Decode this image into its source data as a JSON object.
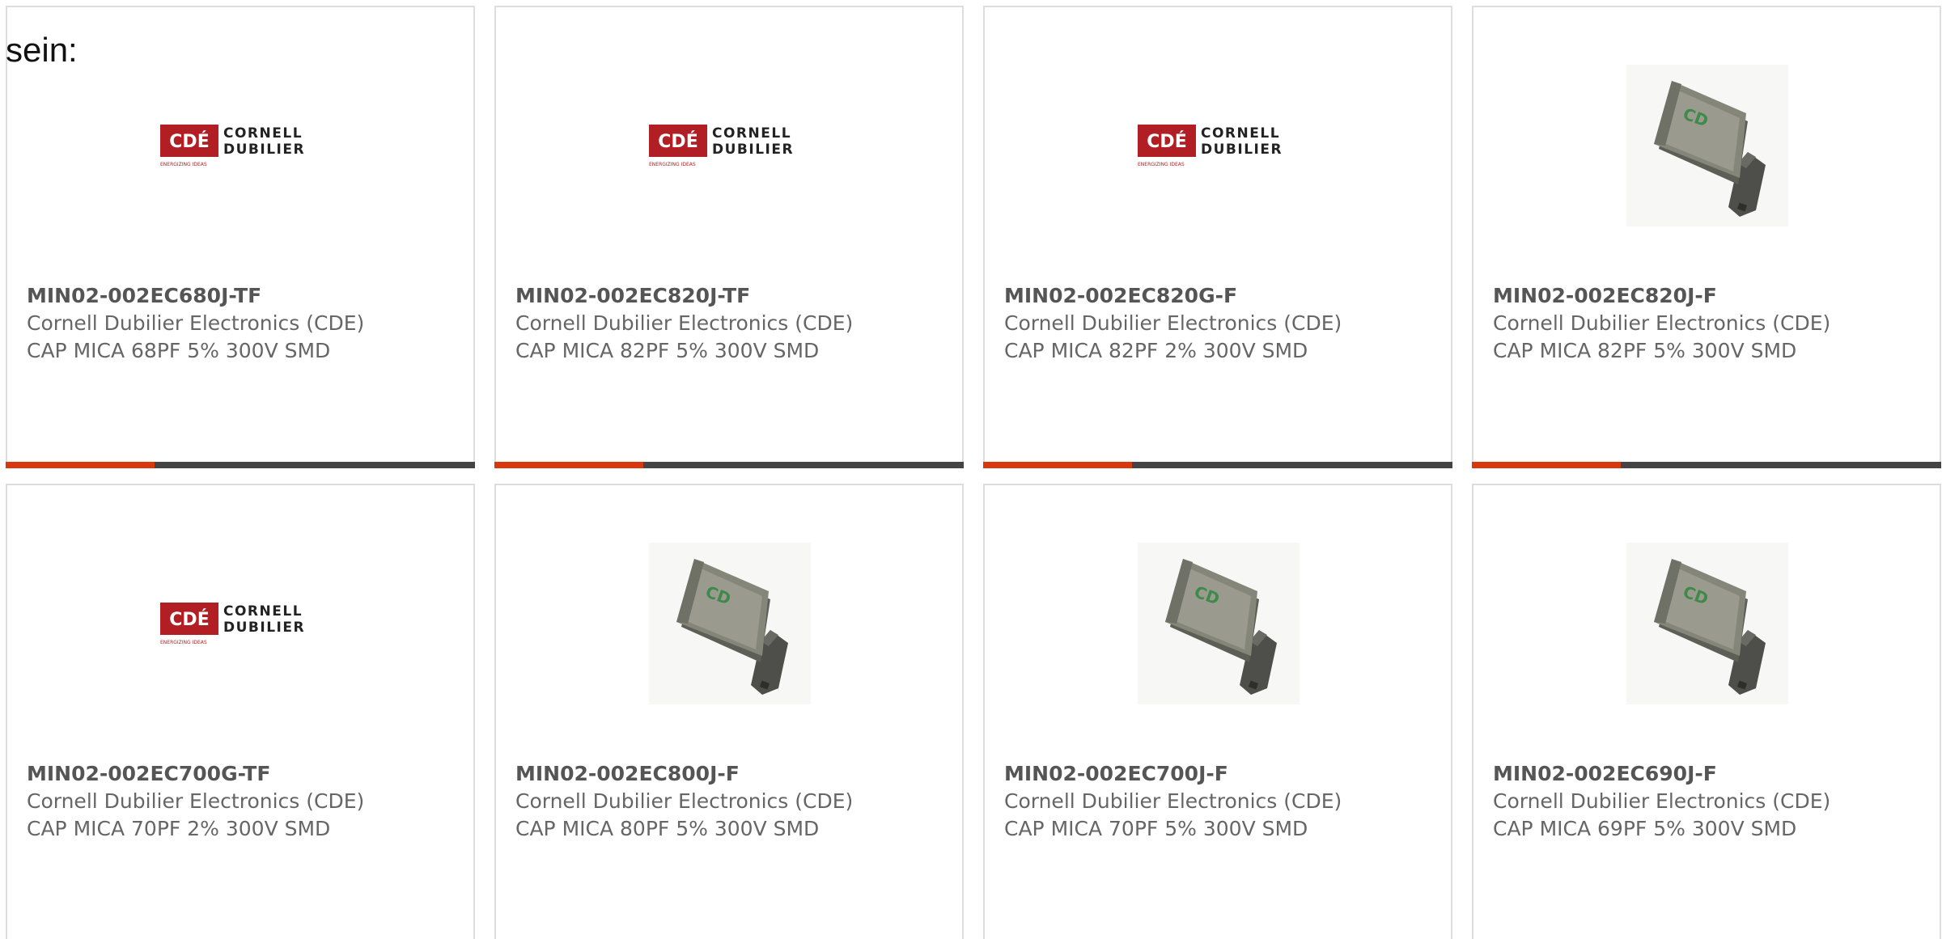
{
  "intro_text": "sein:",
  "brand": {
    "logo_mark": "CDÉ",
    "logo_line1": "CORNELL",
    "logo_line2": "DUBILIER",
    "logo_tagline": "ENERGIZING IDEAS",
    "logo_red": "#b11f24"
  },
  "colors": {
    "accent": "#d9380f",
    "bar": "#444444"
  },
  "products": [
    {
      "part_number": "MIN02-002EC680J-TF",
      "manufacturer": "Cornell Dubilier Electronics (CDE)",
      "description": "CAP MICA 68PF 5% 300V SMD",
      "image": "cde-logo"
    },
    {
      "part_number": "MIN02-002EC820J-TF",
      "manufacturer": "Cornell Dubilier Electronics (CDE)",
      "description": "CAP MICA 82PF 5% 300V SMD",
      "image": "cde-logo"
    },
    {
      "part_number": "MIN02-002EC820G-F",
      "manufacturer": "Cornell Dubilier Electronics (CDE)",
      "description": "CAP MICA 82PF 2% 300V SMD",
      "image": "cde-logo"
    },
    {
      "part_number": "MIN02-002EC820J-F",
      "manufacturer": "Cornell Dubilier Electronics (CDE)",
      "description": "CAP MICA 82PF 5% 300V SMD",
      "image": "capacitor-photo"
    },
    {
      "part_number": "MIN02-002EC700G-TF",
      "manufacturer": "Cornell Dubilier Electronics (CDE)",
      "description": "CAP MICA 70PF 2% 300V SMD",
      "image": "cde-logo"
    },
    {
      "part_number": "MIN02-002EC800J-F",
      "manufacturer": "Cornell Dubilier Electronics (CDE)",
      "description": "CAP MICA 80PF 5% 300V SMD",
      "image": "capacitor-photo"
    },
    {
      "part_number": "MIN02-002EC700J-F",
      "manufacturer": "Cornell Dubilier Electronics (CDE)",
      "description": "CAP MICA 70PF 5% 300V SMD",
      "image": "capacitor-photo"
    },
    {
      "part_number": "MIN02-002EC690J-F",
      "manufacturer": "Cornell Dubilier Electronics (CDE)",
      "description": "CAP MICA 69PF 5% 300V SMD",
      "image": "capacitor-photo"
    }
  ]
}
